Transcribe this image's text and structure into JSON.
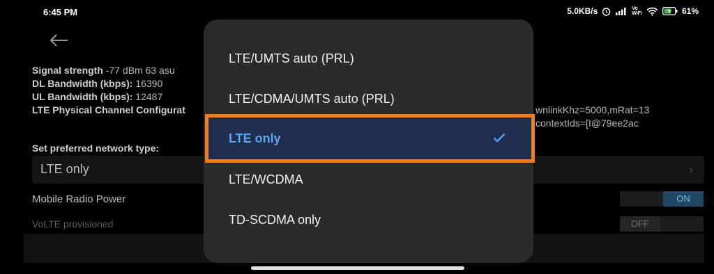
{
  "status": {
    "time": "6:45 PM",
    "net_speed": "5.0KB/s",
    "volte_top": "Vo",
    "volte_bottom": "WiFi",
    "battery": "61%"
  },
  "background": {
    "signal_label": "Signal strength",
    "signal_value": " -77 dBm   63 asu",
    "dl_label": "DL Bandwidth (kbps):",
    "dl_value": " 16390",
    "ul_label": "UL Bandwidth (kbps):",
    "ul_value": " 12487",
    "lte_config_label": "LTE Physical Channel Configurat",
    "lte_config_right_1": "wnlinkKhz=5000,mRat=13",
    "lte_config_right_2": "contextIds=[I@79ee2ac",
    "pref_label": "Set preferred network type:",
    "pref_value": "LTE only",
    "radio_power_label": "Mobile Radio Power",
    "radio_power_state": "ON",
    "volte_label": "VoLTE provisioned",
    "volte_state": "OFF"
  },
  "dialog": {
    "options": [
      {
        "label": "LTE/UMTS auto (PRL)",
        "selected": false
      },
      {
        "label": "LTE/CDMA/UMTS auto (PRL)",
        "selected": false
      },
      {
        "label": "LTE only",
        "selected": true
      },
      {
        "label": "LTE/WCDMA",
        "selected": false
      },
      {
        "label": "TD-SCDMA only",
        "selected": false
      }
    ]
  },
  "colors": {
    "selected_text": "#5aa4f0",
    "selected_bg": "#1d2f4c",
    "highlight": "#f57b20"
  }
}
